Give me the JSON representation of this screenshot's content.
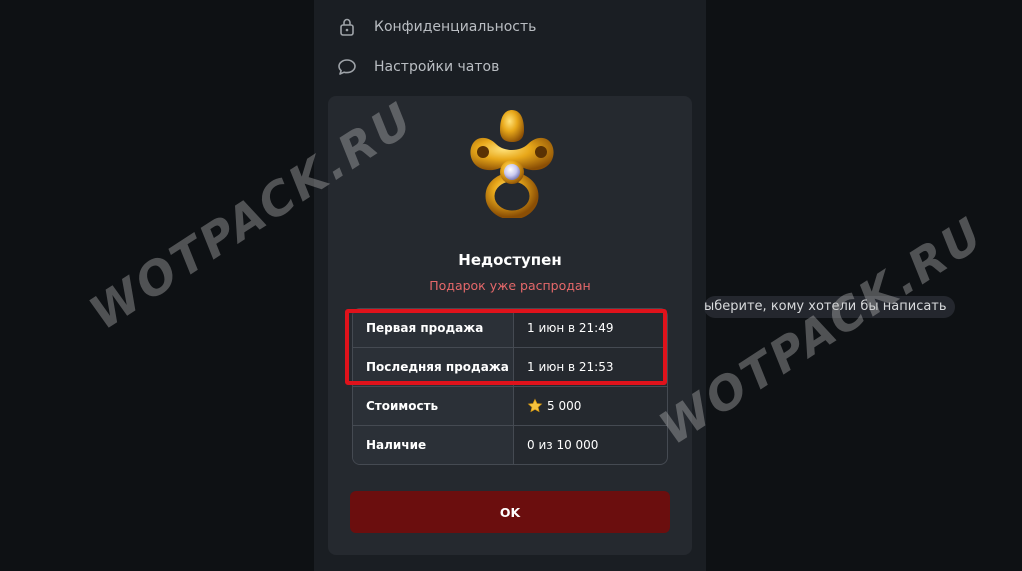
{
  "menu": {
    "privacy": "Конфиденциальность",
    "chat_settings": "Настройки чатов"
  },
  "hint_text": "ыберите, кому хотели бы написать",
  "modal": {
    "title": "Недоступен",
    "subtitle": "Подарок уже распродан",
    "rows": [
      {
        "label": "Первая продажа",
        "value": "1 июн в 21:49"
      },
      {
        "label": "Последняя продажа",
        "value": "1 июн в 21:53"
      },
      {
        "label": "Стоимость",
        "value": "5 000"
      },
      {
        "label": "Наличие",
        "value": "0 из 10 000"
      }
    ],
    "ok_label": "OK"
  },
  "watermark": "WOTPACK.RU",
  "colors": {
    "accent_red": "#e0121b",
    "button_bg": "#6b0e0e",
    "subtitle": "#e5686a"
  },
  "icons": {
    "privacy": "lock-icon",
    "chat_settings": "chat-bubble-icon",
    "price": "star-icon"
  }
}
